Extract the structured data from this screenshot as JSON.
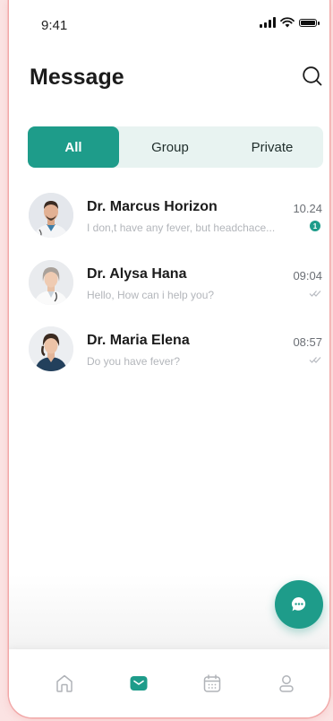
{
  "status_bar": {
    "time": "9:41"
  },
  "header": {
    "title": "Message"
  },
  "tabs": [
    {
      "label": "All",
      "active": true
    },
    {
      "label": "Group",
      "active": false
    },
    {
      "label": "Private",
      "active": false
    }
  ],
  "chats": [
    {
      "name": "Dr. Marcus Horizon",
      "preview": "I don,t have any fever, but headchace...",
      "time": "10.24",
      "unread": "1"
    },
    {
      "name": "Dr. Alysa Hana",
      "preview": "Hello, How can i help you?",
      "time": "09:04",
      "status": "read"
    },
    {
      "name": "Dr. Maria Elena",
      "preview": "Do you have fever?",
      "time": "08:57",
      "status": "read"
    }
  ],
  "colors": {
    "accent": "#1e9c8a",
    "tab_background": "#e8f3f1",
    "preview_text": "#b3b6bb"
  },
  "icons": {
    "search": "search-icon",
    "fab": "chat-bubble-icon",
    "nav": [
      "home-icon",
      "message-icon",
      "calendar-icon",
      "profile-icon"
    ]
  }
}
